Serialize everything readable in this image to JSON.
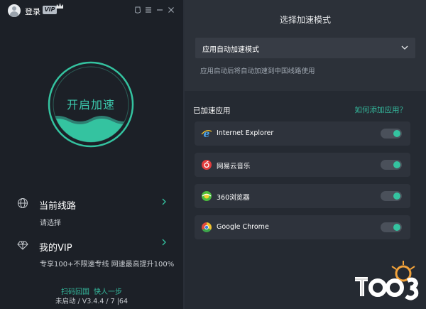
{
  "titlebar": {
    "login": "登录",
    "vip_badge": "VIP"
  },
  "main_button": {
    "label": "开启加速"
  },
  "route": {
    "title": "当前线路",
    "subtitle": "请选择"
  },
  "vip": {
    "title": "我的VIP",
    "subtitle": "专享100+不限速专线 网速最高提升100%"
  },
  "footer": {
    "link1": "扫码回国",
    "link2": "快人一步",
    "version": "未启动 / V3.4.4 / 7 |64"
  },
  "mode": {
    "title": "选择加速模式",
    "selected": "应用自动加速模式",
    "description": "应用启动后将自动加速到中国线路使用"
  },
  "accelerated": {
    "title": "已加速应用",
    "add_link": "如何添加应用？",
    "apps": [
      {
        "name": "Internet Explorer",
        "icon": "ie-icon",
        "enabled": true
      },
      {
        "name": "网易云音乐",
        "icon": "netease-music-icon",
        "enabled": true
      },
      {
        "name": "360浏览器",
        "icon": "360-browser-icon",
        "enabled": true
      },
      {
        "name": "Google Chrome",
        "icon": "chrome-icon",
        "enabled": true
      }
    ]
  },
  "colors": {
    "accent": "#34c3a0",
    "left_bg": "#1c2027",
    "right_bg": "#252a32"
  }
}
